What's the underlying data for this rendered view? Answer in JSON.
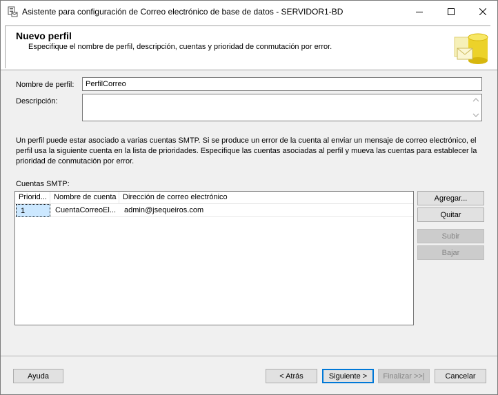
{
  "window": {
    "title": "Asistente para configuración de Correo electrónico de base de datos - SERVIDOR1-BD",
    "controls": {
      "minimize": "minimize-icon",
      "maximize": "maximize-icon",
      "close": "close-icon"
    }
  },
  "header": {
    "title": "Nuevo perfil",
    "subtitle": "Especifique el nombre de perfil, descripción, cuentas y prioridad de conmutación por error."
  },
  "form": {
    "profile_name_label": "Nombre de perfil:",
    "profile_name_value": "PerfilCorreo",
    "description_label": "Descripción:",
    "description_value": ""
  },
  "info_text": "Un perfil puede estar asociado a varias cuentas SMTP. Si se produce un error de la cuenta al enviar un mensaje de correo electrónico, el perfil usa la siguiente cuenta en la lista de prioridades. Especifique las cuentas asociadas al perfil y mueva las cuentas para establecer la prioridad de conmutación por error.",
  "smtp": {
    "label": "Cuentas SMTP:",
    "columns": [
      "Priorid...",
      "Nombre de cuenta",
      "Dirección de correo electrónico"
    ],
    "rows": [
      {
        "priority": "1",
        "account": "CuentaCorreoEl...",
        "email": "admin@jsequeiros.com"
      }
    ]
  },
  "side_buttons": {
    "add": "Agregar...",
    "remove": "Quitar",
    "up": "Subir",
    "down": "Bajar"
  },
  "footer_buttons": {
    "help": "Ayuda",
    "back": "< Atrás",
    "next": "Siguiente >",
    "finish": "Finalizar >>|",
    "cancel": "Cancelar"
  },
  "colors": {
    "selection": "#cce8ff",
    "default_border": "#0078d7",
    "dialog_bg": "#f0f0f0"
  }
}
